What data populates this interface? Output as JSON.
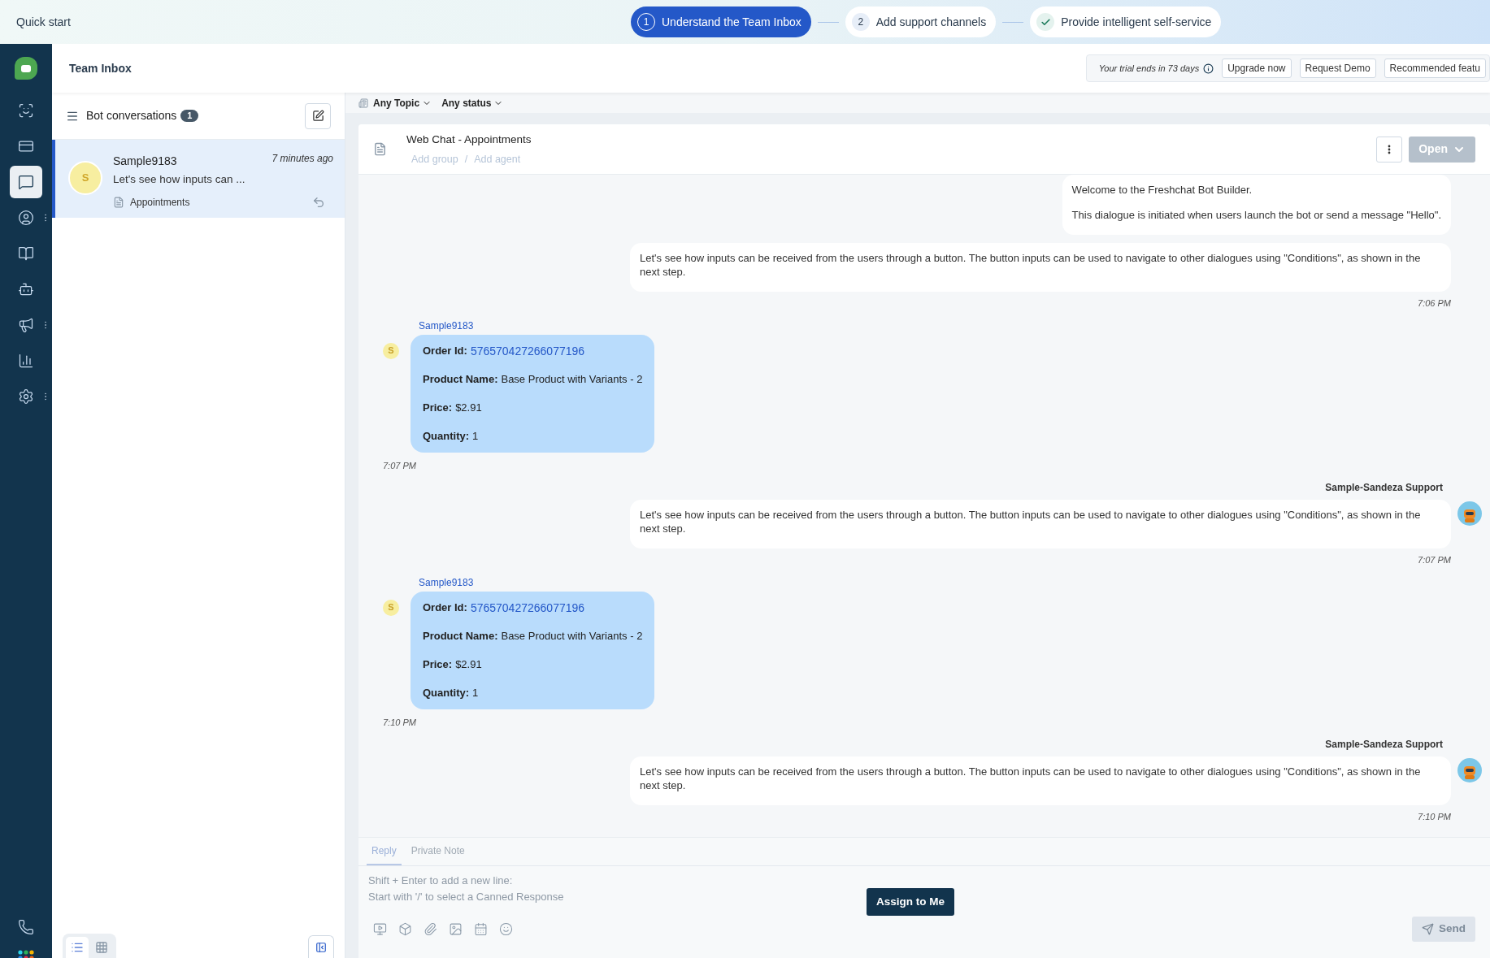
{
  "banner": {
    "title": "Quick start",
    "steps": [
      {
        "number": "1",
        "label": "Understand the Team Inbox",
        "selected": true,
        "done": false
      },
      {
        "number": "2",
        "label": "Add support channels",
        "selected": false,
        "done": false
      },
      {
        "label": "Provide intelligent self-service",
        "selected": false,
        "done": true
      }
    ]
  },
  "nav": [
    {
      "selected": false,
      "has_menu": false
    },
    {
      "selected": false,
      "has_menu": false
    },
    {
      "selected": true,
      "has_menu": false
    },
    {
      "selected": false,
      "has_menu": true
    },
    {
      "selected": false,
      "has_menu": false
    },
    {
      "selected": false,
      "has_menu": false
    },
    {
      "selected": false,
      "has_menu": true
    },
    {
      "selected": false,
      "has_menu": false
    },
    {
      "selected": false,
      "has_menu": true
    }
  ],
  "header": {
    "title": "Team Inbox",
    "trial": "Your trial ends in 73 days",
    "buttons": [
      "Upgrade now",
      "Request Demo",
      "Recommended featu"
    ]
  },
  "list": {
    "title": "Bot conversations",
    "count": "1",
    "conversations": [
      {
        "name": "Sample9183",
        "initial": "S",
        "time": "7 minutes ago",
        "preview": "Let's see how inputs can ...",
        "topic": "Appointments",
        "selected": true
      }
    ],
    "views": [
      {
        "kind": "list",
        "selected": true
      },
      {
        "kind": "grid",
        "selected": false
      }
    ]
  },
  "filters": [
    "Any Topic",
    "Any status"
  ],
  "conversation": {
    "title": "Web Chat - Appointments",
    "add_group": "Add group",
    "separator": "/",
    "add_agent": "Add agent",
    "status": "Open"
  },
  "messages": [
    {
      "kind": "bot",
      "paragraphs": [
        "Welcome to the Freshchat Bot Builder.",
        "This dialogue is initiated when users launch the bot or send a message \"Hello\"."
      ]
    },
    {
      "kind": "bot",
      "paragraphs": [
        "Let's see how inputs can be received from the users through a button. The button inputs can be used to navigate to other dialogues using \"Conditions\", as shown in the next step."
      ],
      "time": "7:06 PM"
    },
    {
      "kind": "user",
      "sender": "Sample9183",
      "initial": "S",
      "fields": [
        {
          "label": "Order Id:",
          "value": "576570427266077196",
          "link": true
        },
        {
          "label": "Product Name:",
          "value": "Base Product with Variants - 2",
          "link": false
        },
        {
          "label": "Price:",
          "value": "$2.91",
          "link": false
        },
        {
          "label": "Quantity:",
          "value": "1",
          "link": false
        }
      ],
      "time": "7:07 PM"
    },
    {
      "kind": "bot",
      "sender": "Sample-Sandeza Support",
      "paragraphs": [
        "Let's see how inputs can be received from the users through a button. The button inputs can be used to navigate to other dialogues using \"Conditions\", as shown in the next step."
      ],
      "time": "7:07 PM"
    },
    {
      "kind": "user",
      "sender": "Sample9183",
      "initial": "S",
      "fields": [
        {
          "label": "Order Id:",
          "value": "576570427266077196",
          "link": true
        },
        {
          "label": "Product Name:",
          "value": "Base Product with Variants - 2",
          "link": false
        },
        {
          "label": "Price:",
          "value": "$2.91",
          "link": false
        },
        {
          "label": "Quantity:",
          "value": "1",
          "link": false
        }
      ],
      "time": "7:10 PM"
    },
    {
      "kind": "bot",
      "sender": "Sample-Sandeza Support",
      "paragraphs": [
        "Let's see how inputs can be received from the users through a button. The button inputs can be used to navigate to other dialogues using \"Conditions\", as shown in the next step."
      ],
      "time": "7:10 PM"
    }
  ],
  "composer": {
    "tabs": [
      {
        "label": "Reply",
        "selected": true
      },
      {
        "label": "Private Note",
        "selected": false
      }
    ],
    "placeholder": "Shift + Enter to add a new line:\nStart with '/' to select a Canned Response",
    "assign": "Assign to Me",
    "send": "Send",
    "send_disabled": true
  }
}
